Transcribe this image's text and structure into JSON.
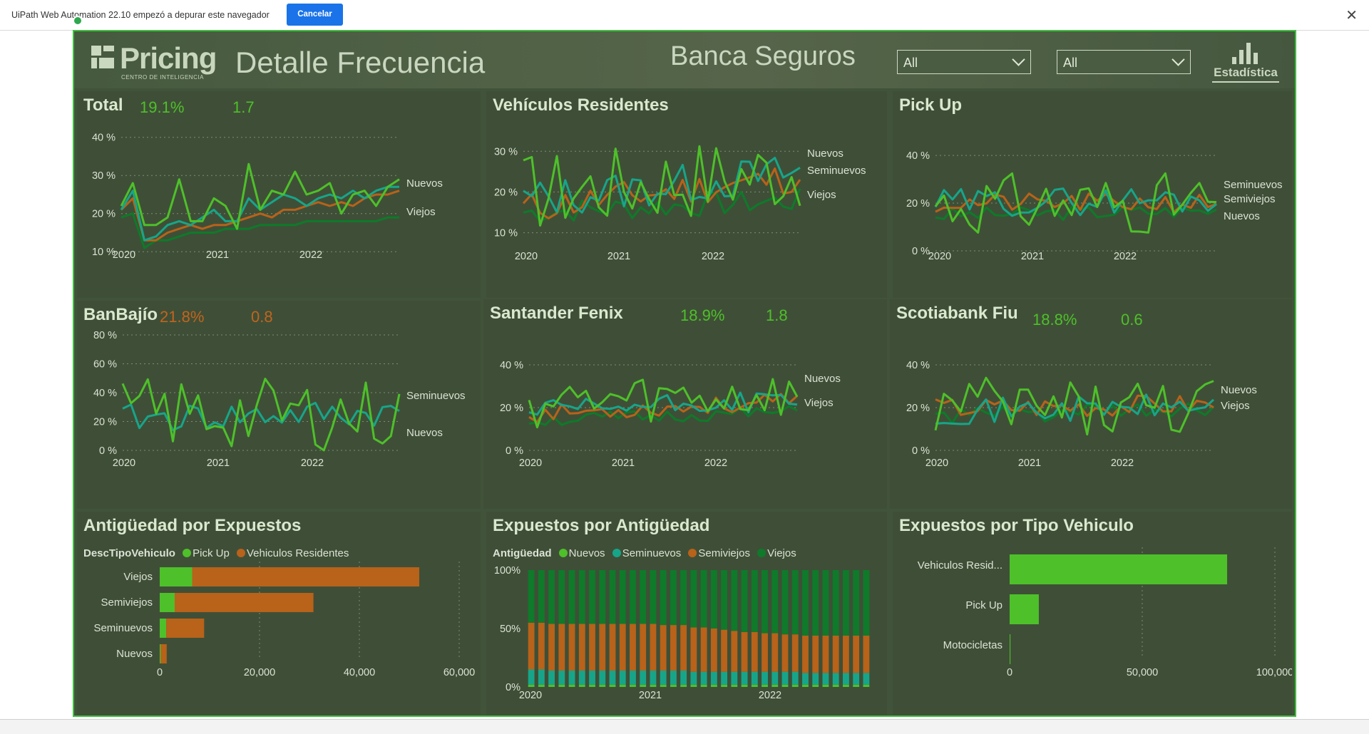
{
  "browser": {
    "infobar_message": "UiPath Web Automation 22.10 empezó a depurar este navegador",
    "cancel_label": "Cancelar",
    "close_glyph": "✕"
  },
  "report": {
    "logo_word": "Pricing",
    "logo_sub": "CENTRO DE INTELIGENCIA",
    "title": "Detalle Frecuencia",
    "bank": "Banca Seguros",
    "slicer1": "All",
    "slicer2": "All",
    "stat_logo_label": "Estadística"
  },
  "colors": {
    "nuevos": "#4ec02a",
    "seminuevos": "#17a58a",
    "semiviejos": "#b8621a",
    "viejos": "#0e7a2a",
    "pickup": "#4ec02a",
    "residentes": "#b8621a"
  },
  "years": [
    "2020",
    "2021",
    "2022"
  ],
  "cards": {
    "total": {
      "title": "Total",
      "kpi1": "19.1%",
      "kpi2": "1.7",
      "yticks": [
        "40 %",
        "30 %",
        "20 %",
        "10 %"
      ],
      "labels": [
        "Nuevos",
        "Viejos"
      ]
    },
    "vehres": {
      "title": "Vehículos Residentes",
      "yticks": [
        "30 %",
        "20 %",
        "10 %"
      ],
      "labels": [
        "Nuevos",
        "Seminuevos",
        "Viejos"
      ]
    },
    "pickup": {
      "title": "Pick Up",
      "yticks": [
        "40 %",
        "20 %",
        "0 %"
      ],
      "labels": [
        "Seminuevos",
        "Semiviejos",
        "Nuevos"
      ]
    },
    "banbajio": {
      "title": "BanBajío",
      "kpi1": "21.8%",
      "kpi2": "0.8",
      "yticks": [
        "80 %",
        "60 %",
        "40 %",
        "20 %",
        "0 %"
      ],
      "labels": [
        "Seminuevos",
        "Nuevos"
      ]
    },
    "santander": {
      "title": "Santander Fenix",
      "kpi1": "18.9%",
      "kpi2": "1.8",
      "yticks": [
        "40 %",
        "20 %",
        "0 %"
      ],
      "labels": [
        "Nuevos",
        "Viejos"
      ]
    },
    "scotia": {
      "title": "Scotiabank Fiu",
      "kpi1": "18.8%",
      "kpi2": "0.6",
      "yticks": [
        "40 %",
        "20 %",
        "0 %"
      ],
      "labels": [
        "Nuevos",
        "Viejos"
      ]
    }
  },
  "antig": {
    "title": "Antigüedad por Expuestos",
    "legend_label": "DescTipoVehiculo",
    "legend": [
      "Pick Up",
      "Vehiculos Residentes"
    ]
  },
  "expant": {
    "title": "Expuestos por Antigüedad",
    "legend_label": "Antigüedad",
    "legend": [
      "Nuevos",
      "Seminuevos",
      "Semiviejos",
      "Viejos"
    ]
  },
  "tipo": {
    "title": "Expuestos por Tipo Vehiculo"
  },
  "chart_data": [
    {
      "type": "bar",
      "title": "Antigüedad por Expuestos",
      "orientation": "horizontal",
      "stacked": true,
      "categories": [
        "Viejos",
        "Semiviejos",
        "Seminuevos",
        "Nuevos"
      ],
      "series": [
        {
          "name": "Pick Up",
          "values": [
            6500,
            3000,
            1300,
            200
          ]
        },
        {
          "name": "Vehiculos Residentes",
          "values": [
            45500,
            27800,
            7600,
            1200
          ]
        }
      ],
      "xlim": [
        0,
        60000
      ],
      "xticks": [
        "0",
        "20,000",
        "40,000",
        "60,000"
      ]
    },
    {
      "type": "bar",
      "title": "Expuestos por Antigüedad",
      "stacked": true,
      "percent": true,
      "x_ticks": [
        "2020",
        "2021",
        "2022"
      ],
      "y_ticks": [
        "100%",
        "50%",
        "0%"
      ],
      "series": [
        {
          "name": "Nuevos",
          "values": [
            0.02,
            0.02,
            0.02,
            0.02,
            0.02,
            0.02,
            0.02,
            0.02,
            0.02,
            0.02,
            0.02,
            0.02,
            0.02,
            0.02,
            0.02,
            0.02,
            0.02,
            0.02,
            0.02,
            0.02,
            0.02,
            0.02,
            0.02,
            0.02,
            0.02,
            0.02,
            0.02,
            0.02,
            0.02,
            0.02,
            0.02,
            0.02,
            0.02,
            0.02
          ]
        },
        {
          "name": "Seminuevos",
          "values": [
            0.13,
            0.13,
            0.12,
            0.12,
            0.12,
            0.12,
            0.12,
            0.12,
            0.12,
            0.12,
            0.12,
            0.12,
            0.12,
            0.12,
            0.12,
            0.12,
            0.11,
            0.11,
            0.11,
            0.11,
            0.11,
            0.11,
            0.11,
            0.11,
            0.11,
            0.11,
            0.11,
            0.1,
            0.1,
            0.1,
            0.1,
            0.1,
            0.1,
            0.1
          ]
        },
        {
          "name": "Semiviejos",
          "values": [
            0.4,
            0.4,
            0.4,
            0.4,
            0.4,
            0.4,
            0.4,
            0.4,
            0.4,
            0.4,
            0.4,
            0.4,
            0.4,
            0.39,
            0.39,
            0.39,
            0.38,
            0.38,
            0.37,
            0.36,
            0.35,
            0.34,
            0.34,
            0.33,
            0.33,
            0.32,
            0.32,
            0.32,
            0.32,
            0.32,
            0.32,
            0.32,
            0.32,
            0.32
          ]
        },
        {
          "name": "Viejos",
          "values": [
            0.45,
            0.45,
            0.46,
            0.46,
            0.46,
            0.46,
            0.46,
            0.46,
            0.46,
            0.46,
            0.46,
            0.46,
            0.46,
            0.47,
            0.47,
            0.47,
            0.49,
            0.49,
            0.5,
            0.51,
            0.52,
            0.53,
            0.53,
            0.54,
            0.54,
            0.55,
            0.55,
            0.56,
            0.56,
            0.56,
            0.56,
            0.56,
            0.56,
            0.56
          ]
        }
      ]
    },
    {
      "type": "bar",
      "title": "Expuestos por Tipo Vehiculo",
      "orientation": "horizontal",
      "categories": [
        "Vehiculos Resid...",
        "Pick Up",
        "Motocicletas"
      ],
      "values": [
        82000,
        11000,
        300
      ],
      "xlim": [
        0,
        100000
      ],
      "xticks": [
        "0",
        "50,000",
        "100,000"
      ]
    },
    {
      "type": "line",
      "title": "Total",
      "ylim": [
        5,
        42
      ],
      "series": [
        {
          "name": "Nuevos",
          "values": [
            22,
            28,
            17,
            17,
            19,
            29,
            18,
            18,
            24,
            22,
            16,
            33,
            21,
            26,
            25,
            31,
            25,
            26,
            28,
            20,
            25,
            26,
            22,
            27,
            29
          ]
        },
        {
          "name": "Seminuevos",
          "values": [
            21,
            26,
            13,
            14,
            17,
            18,
            17,
            19,
            21,
            18,
            18,
            24,
            21,
            23,
            25,
            24,
            22,
            24,
            25,
            24,
            26,
            24,
            26,
            27,
            27
          ]
        },
        {
          "name": "Semiviejos",
          "values": [
            21,
            24,
            13,
            13,
            15,
            16,
            17,
            16,
            17,
            17,
            18,
            19,
            20,
            19,
            21,
            21,
            22,
            23,
            22,
            23,
            22,
            24,
            25,
            25,
            26
          ]
        },
        {
          "name": "Viejos",
          "values": [
            19,
            20,
            11,
            13,
            13,
            14,
            15,
            15,
            15,
            16,
            16,
            16,
            17,
            17,
            17,
            17,
            18,
            18,
            18,
            18,
            18,
            18,
            18,
            19,
            19
          ]
        }
      ]
    }
  ]
}
